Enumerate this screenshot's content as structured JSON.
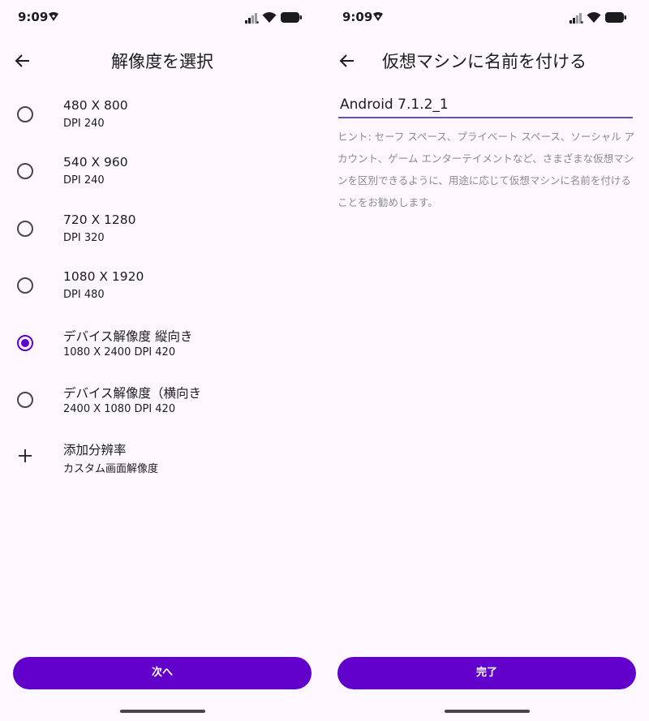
{
  "status_bar": {
    "time": "9:09"
  },
  "resolution_screen": {
    "title": "解像度を選択",
    "items": [
      {
        "primary": "480 X 800",
        "secondary": "DPI 240",
        "selected": false,
        "icon": "radio"
      },
      {
        "primary": "540 X 960",
        "secondary": "DPI 240",
        "selected": false,
        "icon": "radio"
      },
      {
        "primary": "720 X 1280",
        "secondary": "DPI 320",
        "selected": false,
        "icon": "radio"
      },
      {
        "primary": "1080 X 1920",
        "secondary": "DPI 480",
        "selected": false,
        "icon": "radio"
      },
      {
        "primary": "デバイス解像度 縦向き",
        "secondary": "1080 X 2400 DPI 420",
        "selected": true,
        "icon": "radio"
      },
      {
        "primary": "デバイス解像度（横向き",
        "secondary": "2400 X 1080 DPI 420",
        "selected": false,
        "icon": "radio"
      },
      {
        "primary": "添加分辨率",
        "secondary": "カスタム画面解像度",
        "selected": false,
        "icon": "plus-icon"
      }
    ],
    "next_button": "次へ"
  },
  "name_screen": {
    "title": "仮想マシンに名前を付ける",
    "name_value": "Android 7.1.2_1",
    "hint": "ヒント: セーフ スペース、プライベート スペース、ソーシャル アカウント、ゲーム エンターテイメントなど、さまざまな仮想マシンを区別できるように、用途に応じて仮想マシンに名前を付けることをお勧めします。",
    "done_button": "完了"
  },
  "colors": {
    "accent": "#6200cc",
    "background": "#fef7ff",
    "text": "#1c1b1f",
    "hint": "#8d8a92"
  }
}
